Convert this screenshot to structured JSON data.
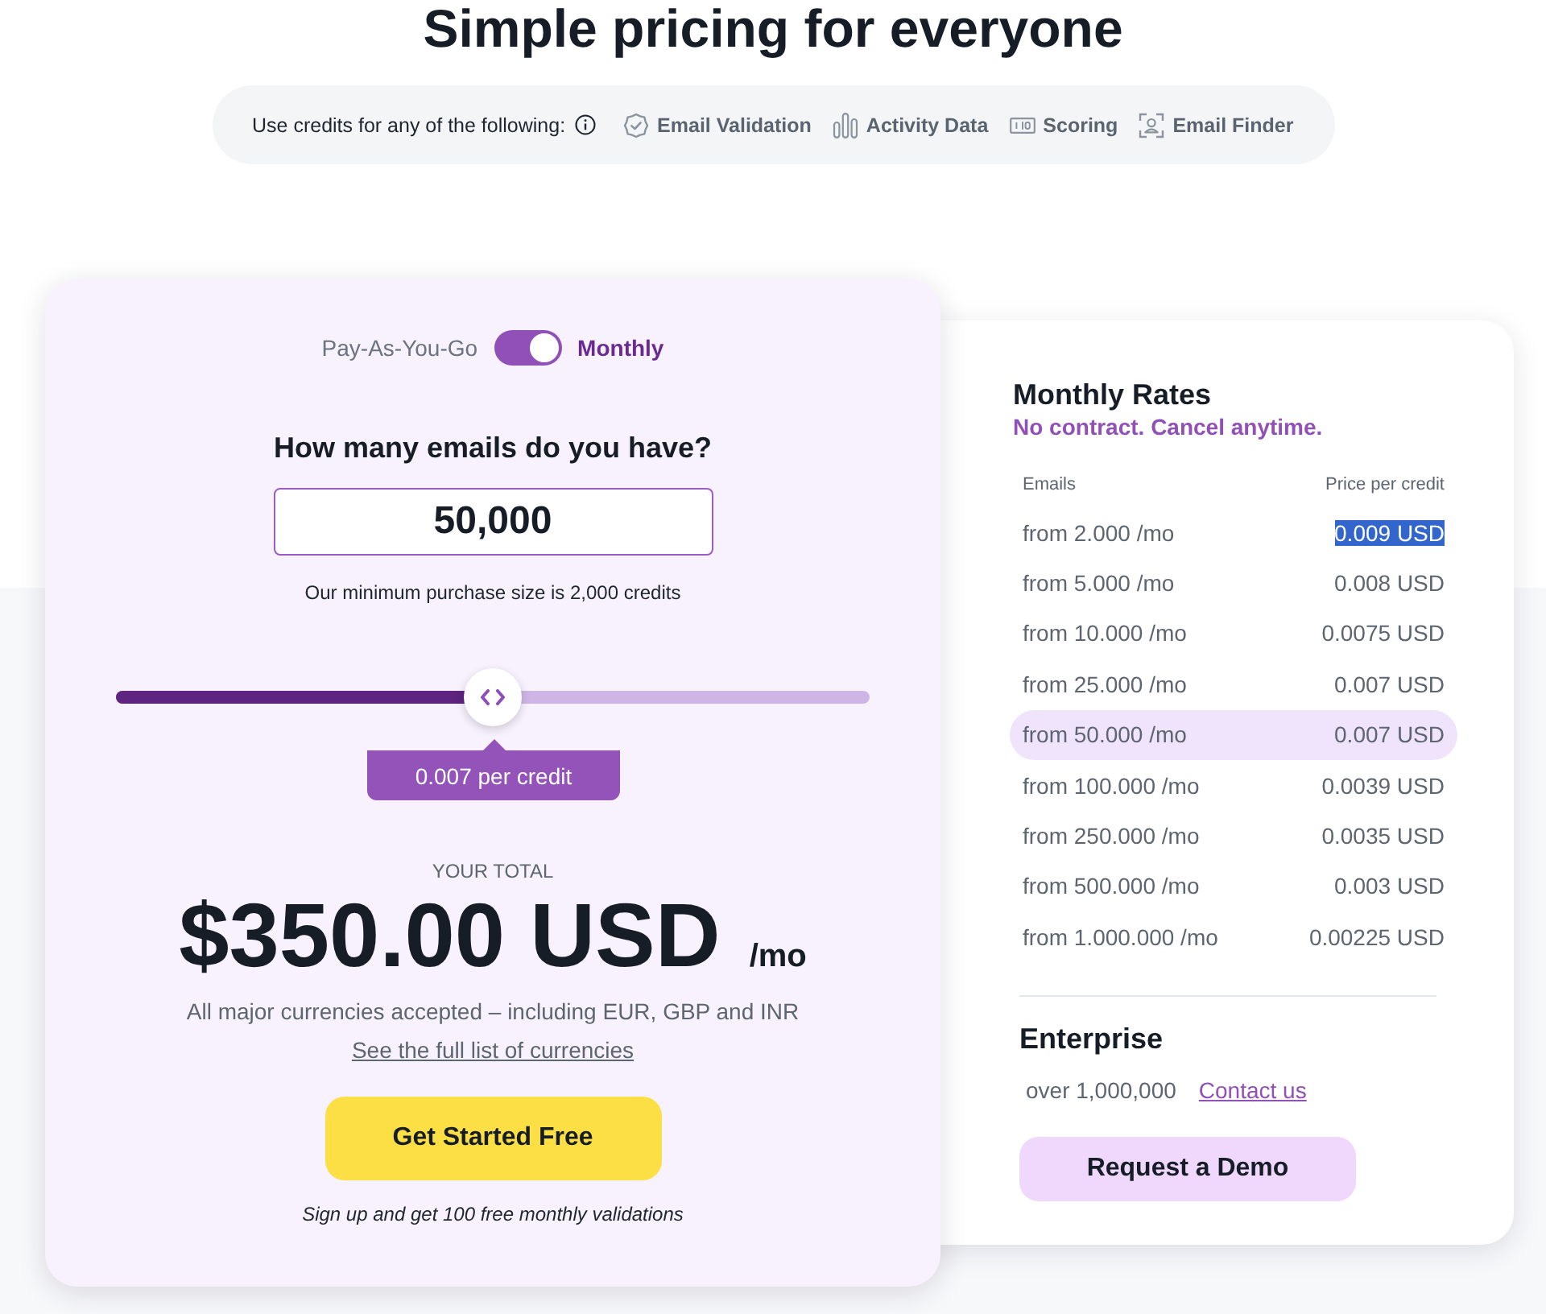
{
  "header": {
    "title": "Simple pricing for everyone"
  },
  "features": {
    "intro": "Use credits for any of the following:",
    "items": [
      {
        "label": "Email Validation",
        "kind": "validation"
      },
      {
        "label": "Activity Data",
        "kind": "activity"
      },
      {
        "label": "Scoring",
        "kind": "scoring"
      },
      {
        "label": "Email Finder",
        "kind": "finder"
      }
    ]
  },
  "calculator": {
    "billing_toggle": {
      "left_label": "Pay-As-You-Go",
      "right_label": "Monthly",
      "on": true
    },
    "question": "How many emails do you have?",
    "emails_field": {
      "value": "50,000"
    },
    "minimum_note": "Our minimum purchase size is 2,000 credits",
    "slider": {
      "level": 0.5,
      "tooltip": "0.007 per credit"
    },
    "total_label": "YOUR TOTAL",
    "total": "$350.00 USD",
    "period": "/mo",
    "currencies_note": "All major currencies accepted – including EUR, GBP and INR",
    "currencies_link": "See the full list of currencies",
    "cta": "Get Started Free",
    "cta_note": "Sign up and get 100 free monthly validations"
  },
  "rates": {
    "title": "Monthly Rates",
    "subtitle": "No contract. Cancel anytime.",
    "columns": [
      "Emails",
      "Price per credit"
    ],
    "rows": [
      {
        "emails": "from 2.000 /mo",
        "price": "0.009 USD",
        "selected": false,
        "price_text_selected": true
      },
      {
        "emails": "from 5.000 /mo",
        "price": "0.008 USD",
        "selected": false,
        "price_text_selected": false
      },
      {
        "emails": "from 10.000 /mo",
        "price": "0.0075 USD",
        "selected": false,
        "price_text_selected": false
      },
      {
        "emails": "from 25.000 /mo",
        "price": "0.007 USD",
        "selected": false,
        "price_text_selected": false
      },
      {
        "emails": "from 50.000 /mo",
        "price": "0.007 USD",
        "selected": true,
        "price_text_selected": false
      },
      {
        "emails": "from 100.000 /mo",
        "price": "0.0039 USD",
        "selected": false,
        "price_text_selected": false
      },
      {
        "emails": "from 250.000 /mo",
        "price": "0.0035 USD",
        "selected": false,
        "price_text_selected": false
      },
      {
        "emails": "from 500.000 /mo",
        "price": "0.003 USD",
        "selected": false,
        "price_text_selected": false
      },
      {
        "emails": "from 1.000.000 /mo",
        "price": "0.00225 USD",
        "selected": false,
        "price_text_selected": false
      }
    ]
  },
  "enterprise": {
    "title": "Enterprise",
    "volume": "over 1,000,000",
    "link": "Contact us",
    "button": "Request a Demo"
  }
}
